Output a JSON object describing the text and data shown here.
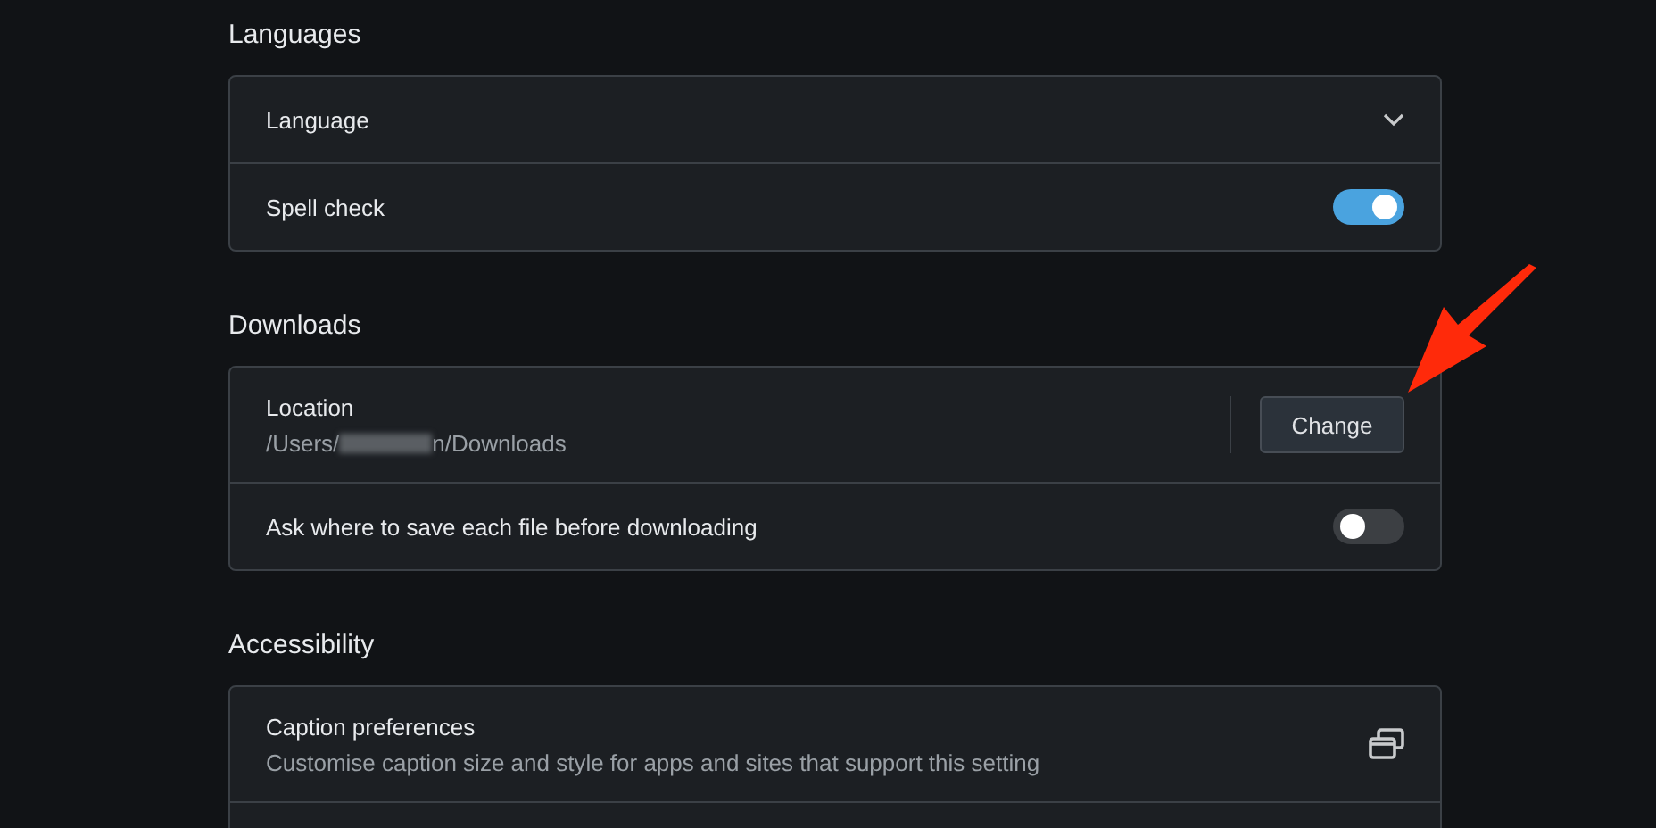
{
  "sections": [
    {
      "title": "Languages",
      "rows": [
        {
          "kind": "dropdown",
          "label": "Language",
          "expanded": false
        },
        {
          "kind": "toggle",
          "label": "Spell check",
          "on": true
        }
      ]
    },
    {
      "title": "Downloads",
      "rows": [
        {
          "kind": "button",
          "label": "Location",
          "path_start": "/Users/",
          "path_end": "n/Downloads",
          "button": "Change"
        },
        {
          "kind": "toggle",
          "label": "Ask where to save each file before downloading",
          "on": false
        }
      ]
    },
    {
      "title": "Accessibility",
      "rows": [
        {
          "kind": "external",
          "label": "Caption preferences",
          "description": "Customise caption size and style for apps and sites that support this setting"
        },
        {
          "kind": "blank"
        }
      ]
    }
  ]
}
